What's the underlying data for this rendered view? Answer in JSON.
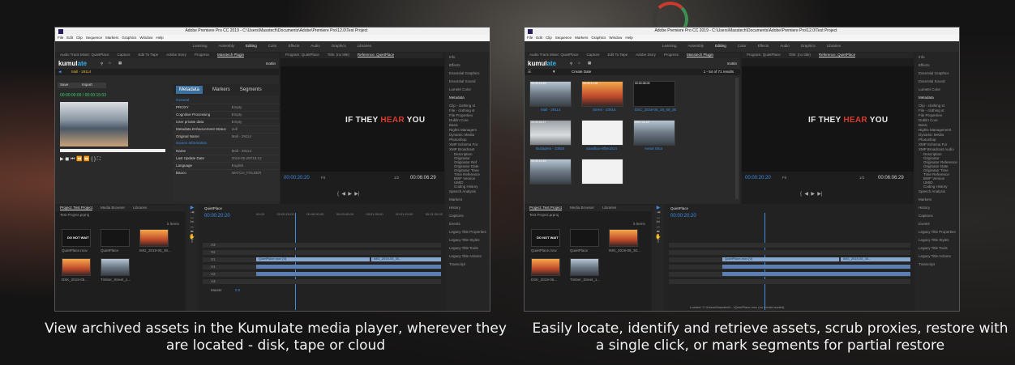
{
  "left": {
    "window_title": "Adobe Premiere Pro CC 2019 - C:\\Users\\Masstech\\Documents\\Adobe\\Premiere Pro\\12.0\\Test Project",
    "menu": [
      "File",
      "Edit",
      "Clip",
      "Sequence",
      "Markers",
      "Graphics",
      "Window",
      "Help"
    ],
    "workspaces": [
      "Learning",
      "Assembly",
      "Editing",
      "Color",
      "Effects",
      "Audio",
      "Graphics",
      "Libraries"
    ],
    "panel_tabs": [
      "Audio Track Mixer: QuietPlace",
      "Capture",
      "Edit To Tape",
      "Adobe Story",
      "Progress",
      "Masstech Plugin"
    ],
    "program_tabs": [
      "Program: QuietPlace",
      "Title: (no title)",
      "Reference: QuietPlace"
    ],
    "kumulate_logo_a": "kumul",
    "kumulate_logo_b": "ate",
    "user": "mottin",
    "asset_title": "Mall - 29114",
    "save_label": "Save",
    "import_label": "Import",
    "player_timecode": "00:00:00:00 / 00:00:15:03",
    "md_tabs": [
      "Metadata",
      "Markers",
      "Segments"
    ],
    "md_section1": "General",
    "md_section2": "Source Information",
    "md_rows": [
      {
        "k": "PROXY",
        "v": "Empty"
      },
      {
        "k": "Cognitive Processing",
        "v": "Empty"
      },
      {
        "k": "User private data",
        "v": "Empty"
      },
      {
        "k": "Metadata Enhancement Status",
        "v": "null"
      },
      {
        "k": "Original Name",
        "v": "Mall - 29114"
      },
      {
        "k": "Name",
        "v": "Mall - 29114"
      },
      {
        "k": "Last Update Date",
        "v": "2019-05-29T16:12"
      },
      {
        "k": "Language",
        "v": "English"
      },
      {
        "k": "Baoco",
        "v": "WATCH_FOLDER"
      }
    ],
    "program_title_a": "IF THEY ",
    "program_title_b": "HEAR",
    "program_title_c": " YOU",
    "program_tc": "00:00:20:20",
    "program_fit": "Fit",
    "program_quality": "1/2",
    "program_duration": "00:06:06:29",
    "right_items": [
      "Info",
      "Effects",
      "Essential Graphics",
      "Essential Sound",
      "Lumetri Color",
      "Metadata",
      "Clip - clothing st",
      "File - clothing st",
      "File Properties",
      "Dublin Core",
      "Basic",
      "Rights Managem",
      "Dynamic Media",
      "Photoshop",
      "XMP Schema For",
      "XMP Broadcast",
      "Description",
      "Originator",
      "Originator Ref",
      "Originator Date",
      "Originator Time",
      "Time Reference",
      "BWF Version",
      "UMID",
      "Coding History",
      "Speech Analysis",
      "Markers",
      "History",
      "Captions",
      "Events",
      "Legacy Title Properties",
      "Legacy Title Styles",
      "Legacy Title Tools",
      "Legacy Title Actions",
      "Transcript"
    ],
    "project_tabs": [
      "Project: Test Project",
      "Media Browser",
      "Libraries"
    ],
    "project_file": "Test Project.prproj",
    "item_count": "5 Items",
    "thumb_labels": [
      "QuietPlace.mov",
      "QuietPlace",
      "IMG_2019-05_30...",
      "DSK_2019-05...",
      "Timber_Street_1..."
    ],
    "thumb_durations": [
      "3:52:21",
      "3:52:21",
      "6:03:00",
      "4:35:21",
      "3:41:07"
    ],
    "dont_wait": "DO NOT WAIT",
    "seq_tab": "QuietPlace",
    "seq_tc": "00:00:20:20",
    "ruler": [
      "00:00",
      "00:00:15:00",
      "00:00:30:00",
      "00:00:45:00",
      "00:01:00:00",
      "00:01:15:00",
      "00:01:30:00"
    ],
    "track_names": [
      "V3",
      "V2",
      "V1",
      "A1",
      "A2",
      "A3",
      "Master"
    ],
    "clip_label": "QuietPlace.mov [V]",
    "clip_label2": "IMG_2019-05_30...",
    "master_val": "0.0"
  },
  "right_shot": {
    "window_title": "Adobe Premiere Pro CC 2019 - C:\\Users\\Masstech\\Documents\\Adobe\\Premiere Pro\\12.0\\Test Project",
    "menu": [
      "File",
      "Edit",
      "Clip",
      "Sequence",
      "Markers",
      "Graphics",
      "Window",
      "Help"
    ],
    "workspaces": [
      "Learning",
      "Assembly",
      "Editing",
      "Color",
      "Effects",
      "Audio",
      "Graphics",
      "Libraries"
    ],
    "panel_tabs": [
      "Audio Track Mixer: QuietPlace",
      "Capture",
      "Edit To Tape",
      "Adobe Story",
      "Progress",
      "Masstech Plugin"
    ],
    "program_tabs": [
      "Program: QuietPlace",
      "Title: (no title)",
      "Reference: QuietPlace"
    ],
    "kumulate_logo_a": "kumul",
    "kumulate_logo_b": "ate",
    "user": "mottin",
    "sort_label": "Create Date",
    "results": "1 - 54 of 71 results",
    "grid_items": [
      {
        "name": "Mall - 29114",
        "time": "00:00:15:03",
        "style": "city"
      },
      {
        "name": "Street - 23916",
        "time": "00:00:11:08",
        "style": "sun"
      },
      {
        "name": "DSC_2019-05_29_09_36",
        "time": "00:00:08:09",
        "style": "dark"
      },
      {
        "name": "Budapest - 23924",
        "time": "00:00:09:17",
        "style": "snow"
      },
      {
        "name": "Sandbox-8f0e1014",
        "time": "",
        "style": "white"
      },
      {
        "name": "Aerial Shot",
        "time": "2017-11-22",
        "style": "city"
      },
      {
        "name": "",
        "time": "00:00:10:23",
        "style": "city"
      },
      {
        "name": "",
        "time": "",
        "style": "white"
      }
    ],
    "program_title_a": "IF THEY ",
    "program_title_b": "HEAR",
    "program_title_c": " YOU",
    "program_tc": "00:00:20:20",
    "program_fit": "Fit",
    "program_quality": "1/2",
    "program_duration": "00:06:06:29",
    "right_items": [
      "Info",
      "Effects",
      "Essential Graphics",
      "Essential Sound",
      "Lumetri Color",
      "Metadata",
      "Clip - clothing st",
      "File - clothing st",
      "File Properties",
      "Dublin Core",
      "Basic",
      "Rights Management",
      "Dynamic Media",
      "Photoshop",
      "XMP Schema For",
      "XMP Broadcast Audio",
      "Description",
      "Originator",
      "Originator Reference",
      "Originator Date",
      "Originator Time",
      "Time Reference",
      "BWF Version",
      "UMID",
      "Coding History",
      "Speech Analysis",
      "Markers",
      "History",
      "Captions",
      "Events",
      "Legacy Title Properties",
      "Legacy Title Styles",
      "Legacy Title Tools",
      "Legacy Title Actions",
      "Transcript"
    ],
    "project_tabs": [
      "Project: Test Project",
      "Media Browser",
      "Libraries"
    ],
    "project_file": "Test Project.prproj",
    "item_count": "5 Items",
    "thumb_labels": [
      "QuietPlace.mov",
      "QuietPlace",
      "IMG_2019-05_30...",
      "DSK_2019-05...",
      "Timber_Street_1..."
    ],
    "thumb_durations": [
      "3:52:21",
      "3:52:21",
      "6:03:00",
      "4:35:21",
      "3:41:07"
    ],
    "dont_wait": "DO NOT WAIT",
    "seq_tab": "QuietPlace",
    "seq_tc": "00:00:20:20",
    "clip_label": "QuietPlace.mov [V]",
    "clip_label2": "IMG_2019-05_30...",
    "status": "Loaded: C:\\Users\\Masstech\\...\\QuietPlace.mov (no media loaded)"
  },
  "captions": {
    "left_line1": "View archived assets in the Kumulate media player, wherever they",
    "left_line2": "are located - disk, tape or cloud",
    "right_line1": "Easily locate, identify and retrieve assets, scrub proxies, restore with",
    "right_line2": "a single click, or mark segments for partial restore"
  },
  "colors": {
    "accent": "#3b8fe6",
    "kumulate_blue": "#36b0ea",
    "red": "#d63b2f",
    "clip": "#5b7fb3"
  }
}
